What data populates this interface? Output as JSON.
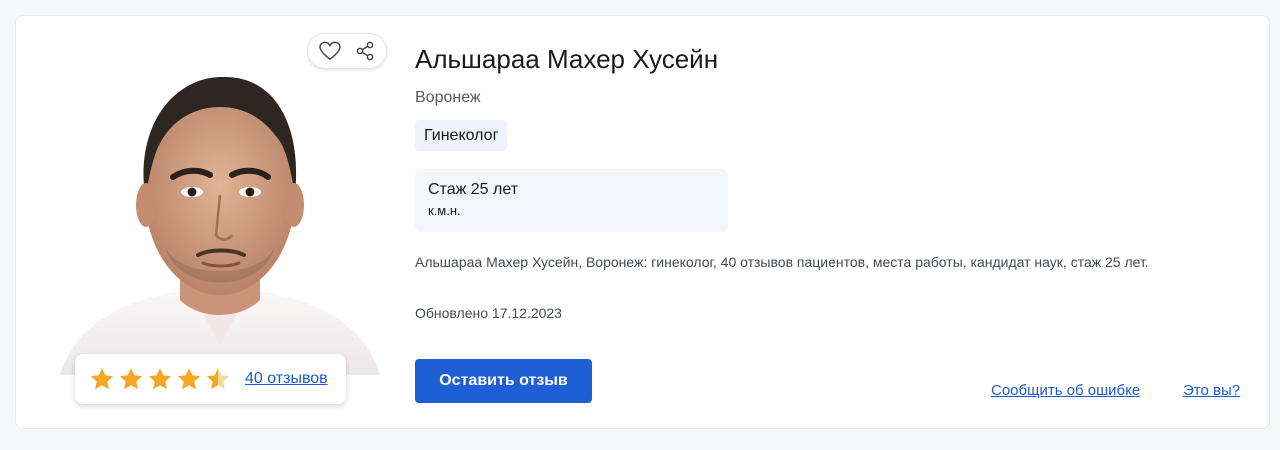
{
  "doctor": {
    "name": "Альшараа Махер Хусейн",
    "city": "Воронеж",
    "specialty": "Гинеколог",
    "experience": "Стаж 25 лет",
    "degree": "к.м.н.",
    "description": "Альшараа Махер Хусейн, Воронеж: гинеколог, 40 отзывов пациентов, места работы, кандидат наук, стаж 25 лет.",
    "updated": "Обновлено 17.12.2023"
  },
  "rating": {
    "stars": 4.5,
    "max_stars": 5,
    "reviews_label": "40 отзывов"
  },
  "actions": {
    "favorite_icon": "heart-icon",
    "share_icon": "share-icon",
    "leave_review_label": "Оставить отзыв",
    "report_error_label": "Сообщить об ошибке",
    "is_it_you_label": "Это вы?"
  },
  "colors": {
    "primary": "#1e5fd6",
    "link": "#1a5bd1",
    "star": "#f5a623",
    "tag_bg": "#eef3fb"
  }
}
